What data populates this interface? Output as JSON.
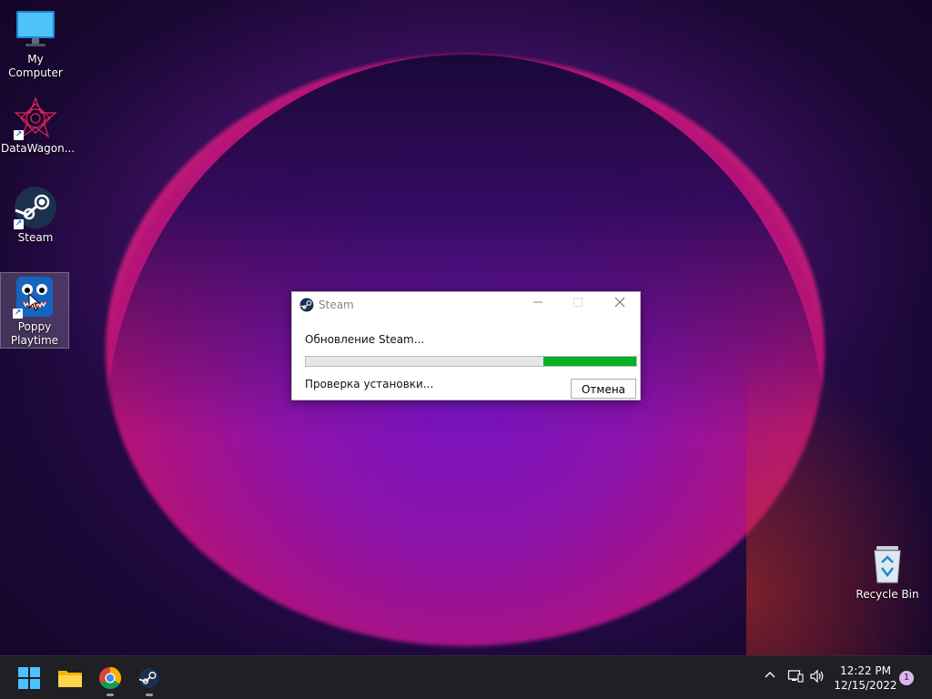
{
  "desktop": {
    "icons": [
      {
        "label": "My Computer",
        "icon": "monitor-icon"
      },
      {
        "label": "DataWagon...",
        "icon": "datawagon-icon"
      },
      {
        "label": "Steam",
        "icon": "steam-icon"
      },
      {
        "label": "Poppy Playtime",
        "icon": "poppy-playtime-icon"
      },
      {
        "label": "Recycle Bin",
        "icon": "recycle-bin-icon"
      }
    ]
  },
  "dialog": {
    "title": "Steam",
    "status_main": "Обновление Steam...",
    "status_sub": "Проверка установки...",
    "cancel_label": "Отмена",
    "progress": 0.28,
    "progress_color": "#06b025"
  },
  "taskbar": {
    "apps": [
      "start-icon",
      "file-explorer-icon",
      "chrome-icon",
      "steam-icon"
    ],
    "tray": [
      "chevron-up-icon",
      "network-icon",
      "volume-icon"
    ],
    "time": "12:22 PM",
    "date": "12/15/2022",
    "notification_count": "1"
  }
}
